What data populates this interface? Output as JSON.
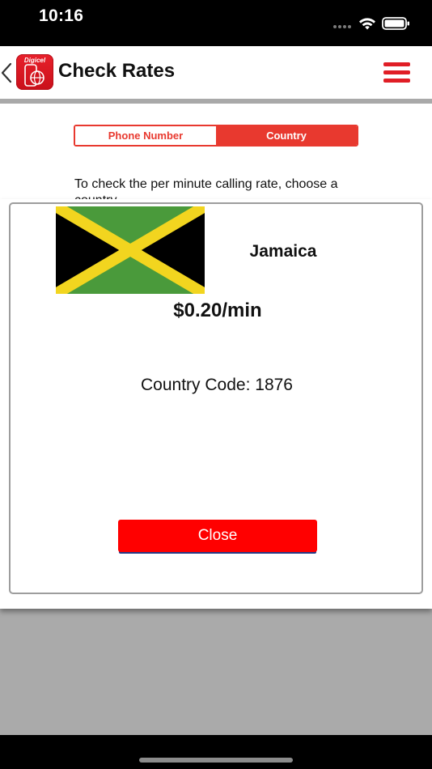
{
  "status_bar": {
    "time": "10:16",
    "icons": [
      "signal-dots-icon",
      "wifi-icon",
      "battery-icon"
    ]
  },
  "nav": {
    "back_icon": "chevron-left-icon",
    "logo_text": "Digicel",
    "title": "Check Rates",
    "menu_icon": "hamburger-menu-icon"
  },
  "segmented": {
    "options": [
      "Phone Number",
      "Country"
    ],
    "selected": "Country"
  },
  "instructions": "To check the per minute calling rate, choose a country",
  "modal": {
    "country_name": "Jamaica",
    "flag_icon": "jamaica-flag-icon",
    "rate": "$0.20/min",
    "country_code_label": "Country Code:",
    "country_code_value": "1876",
    "close_label": "Close"
  },
  "colors": {
    "accent_red": "#e8392f",
    "button_red": "#ff0000",
    "menu_red": "#e01e26",
    "backdrop_gray": "#aaaaaa",
    "flag_green": "#4a9a3b",
    "flag_yellow": "#f2d51f",
    "flag_black": "#000000"
  }
}
